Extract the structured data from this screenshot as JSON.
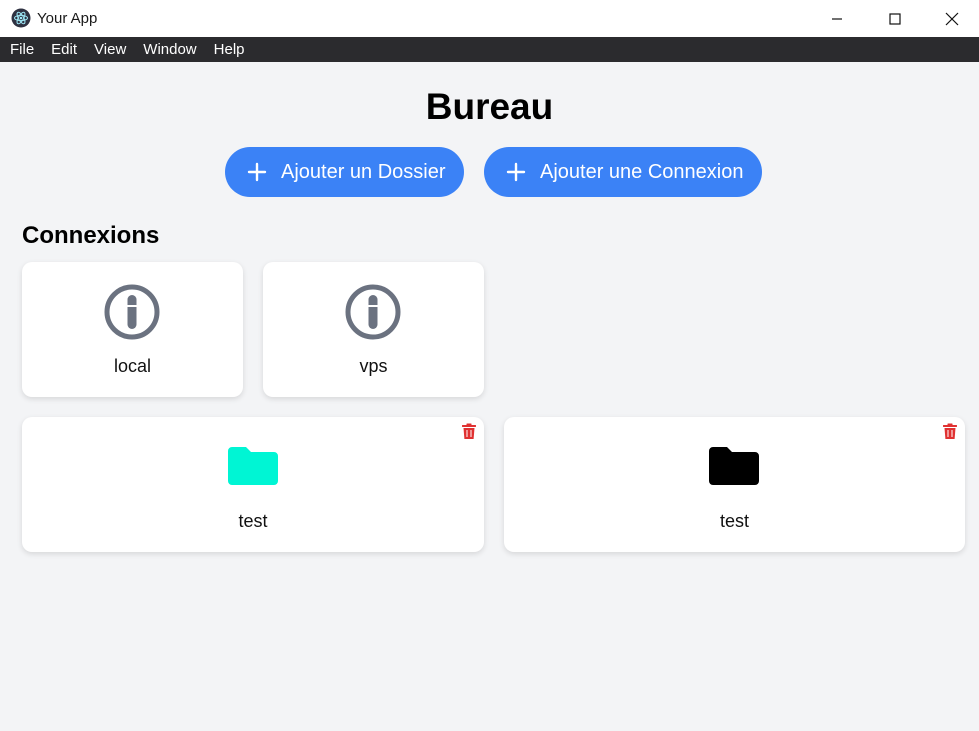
{
  "window": {
    "title": "Your App"
  },
  "menu": [
    "File",
    "Edit",
    "View",
    "Window",
    "Help"
  ],
  "page": {
    "title": "Bureau",
    "add_folder_label": "Ajouter un Dossier",
    "add_connection_label": "Ajouter une Connexion",
    "connections_heading": "Connexions"
  },
  "connections": [
    {
      "name": "local",
      "icon": "connection-icon"
    },
    {
      "name": "vps",
      "icon": "connection-icon"
    }
  ],
  "folders": [
    {
      "name": "test",
      "color": "#00f5d4",
      "icon": "folder-icon"
    },
    {
      "name": "test",
      "color": "#000000",
      "icon": "folder-icon"
    }
  ],
  "colors": {
    "accent": "#3b82f6",
    "delete": "#e03131",
    "connection_icon": "#6b7280"
  }
}
